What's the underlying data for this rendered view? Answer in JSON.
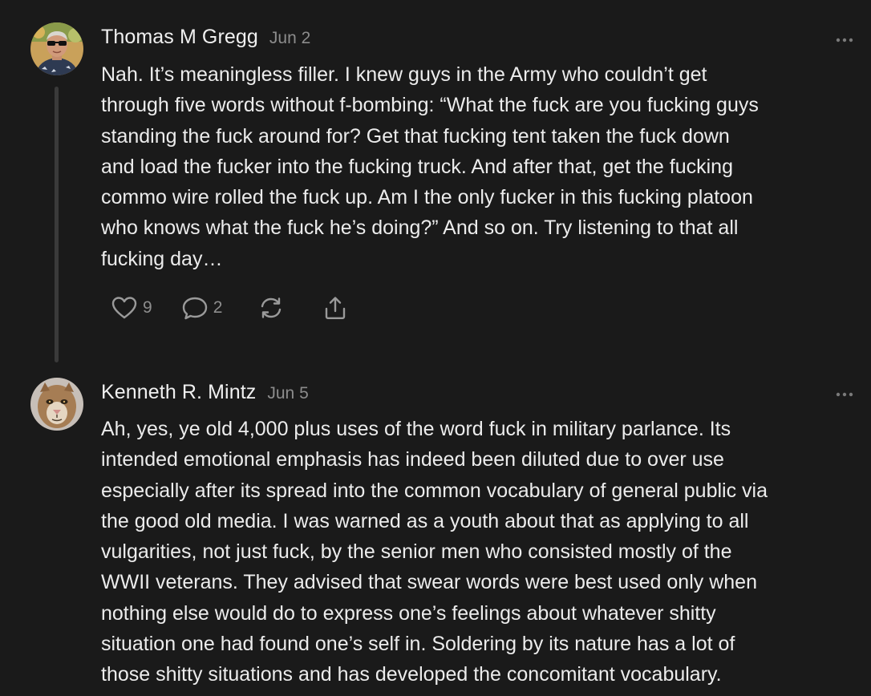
{
  "comments": [
    {
      "author": "Thomas M Gregg",
      "date": "Jun 2",
      "body_lines": [
        "Nah. It’s meaningless filler. I knew guys in the Army who couldn’t get",
        "through five words without f-bombing: “What the fuck are you fucking guys",
        "standing the fuck around for? Get that fucking tent taken the fuck down",
        "and load the fucker into the fucking truck. And after that, get the fucking",
        "commo wire rolled the fuck up. Am I the only fucker in this fucking platoon",
        "who knows what the fuck he’s doing?” And so on. Try listening to that all",
        "fucking day…"
      ],
      "likes": "9",
      "replies": "2",
      "icons": [
        "heart-icon",
        "comment-icon",
        "restack-icon",
        "share-icon",
        "more-dots-icon"
      ]
    },
    {
      "author": "Kenneth R. Mintz",
      "date": "Jun 5",
      "body_lines": [
        "Ah, yes, ye old 4,000 plus uses of the word fuck in military parlance. Its",
        "intended emotional emphasis has indeed been diluted due to over use",
        "especially after its spread into the common vocabulary of general public via",
        "the good old media. I was warned as a youth about that as applying to all",
        "vulgarities, not just fuck, by the senior men who consisted mostly of the",
        "WWII veterans. They advised that swear words were best used only when",
        "nothing else would do to express one’s feelings about whatever shitty",
        "situation one had found one’s self in. Soldering by its nature has a lot of",
        "those shitty situations and has developed the concomitant vocabulary."
      ],
      "icons": [
        "more-dots-icon"
      ]
    }
  ],
  "colors": {
    "background": "#1a1a1a",
    "text": "#ececec",
    "muted": "#8c8c8c",
    "thread_line": "#3a3a3a"
  }
}
